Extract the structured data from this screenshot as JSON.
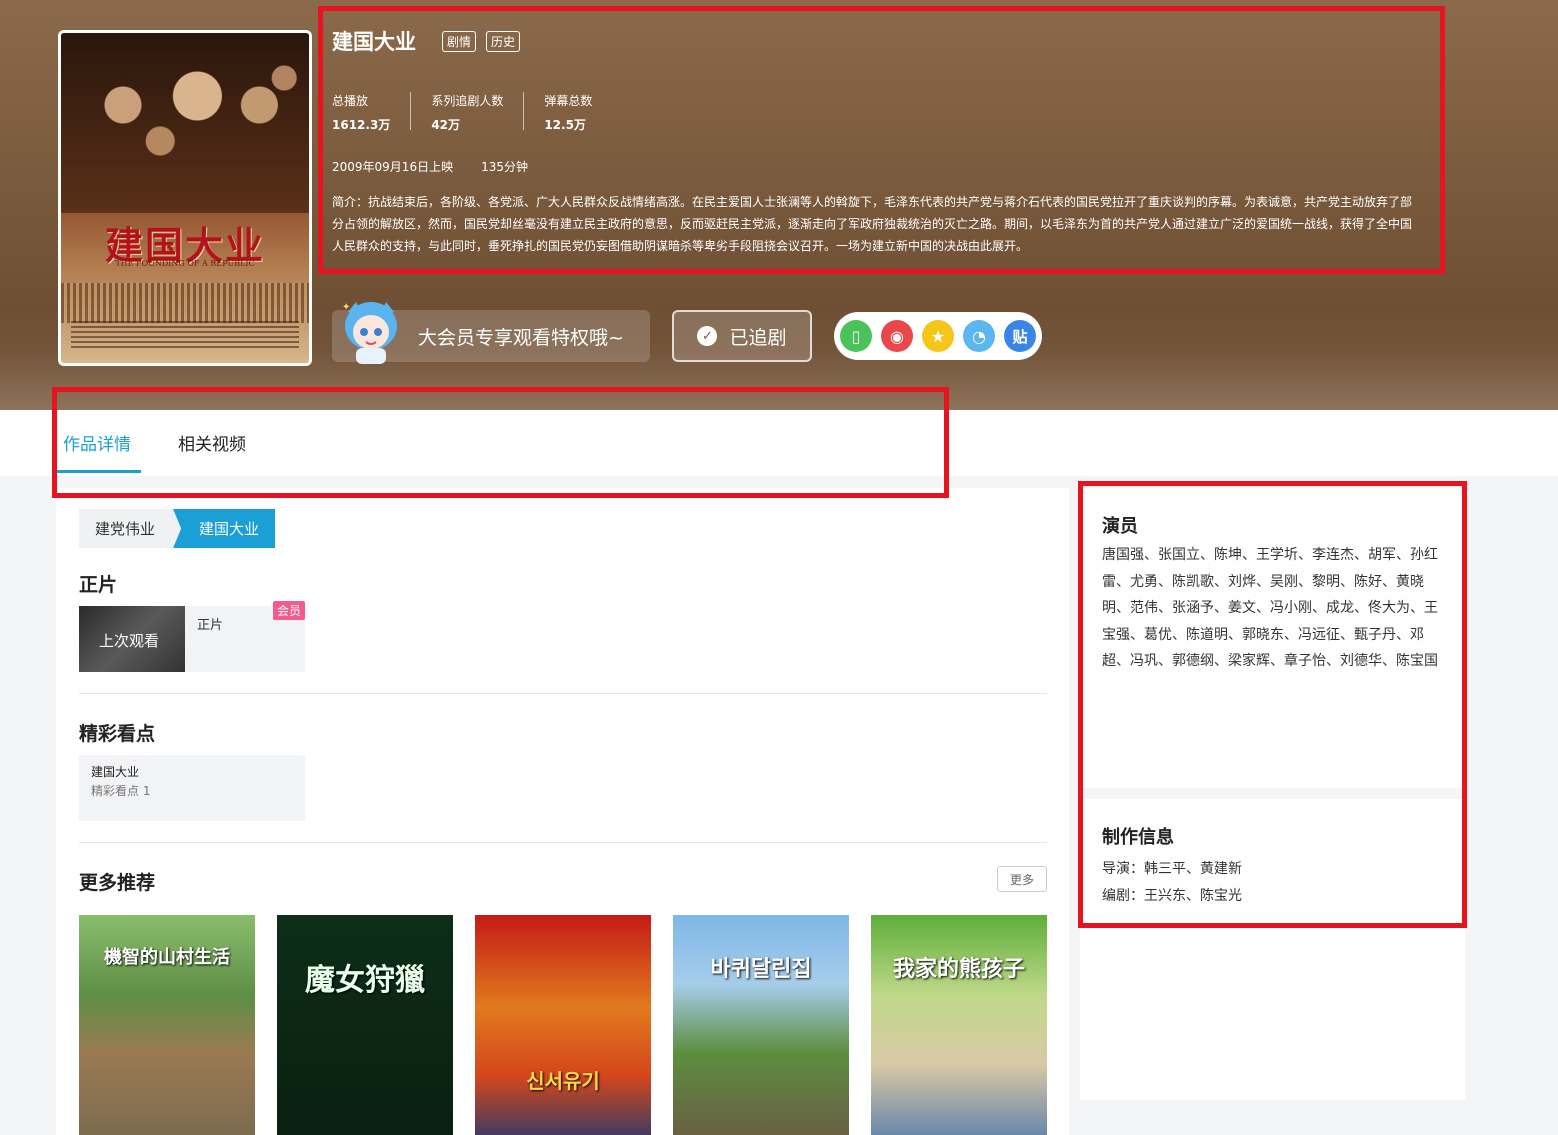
{
  "show": {
    "title": "建国大业",
    "tags": [
      "剧情",
      "历史"
    ],
    "poster": {
      "title": "建国大业",
      "subtitle": "THE FOUNDING OF A REPUBLIC"
    },
    "stats": [
      {
        "label": "总播放",
        "value": "1612.3万"
      },
      {
        "label": "系列追剧人数",
        "value": "42万"
      },
      {
        "label": "弹幕总数",
        "value": "12.5万"
      }
    ],
    "release": "2009年09月16日上映",
    "duration": "135分钟",
    "description": "简介：抗战结束后，各阶级、各党派、广大人民群众反战情绪高涨。在民主爱国人士张澜等人的斡旋下，毛泽东代表的共产党与蒋介石代表的国民党拉开了重庆谈判的序幕。为表诚意，共产党主动放弃了部分占领的解放区，然而，国民党却丝毫没有建立民主政府的意思，反而驱赶民主党派，逐渐走向了军政府独裁统治的灭亡之路。期间，以毛泽东为首的共产党人通过建立广泛的爱国统一战线，获得了全中国人民群众的支持，与此同时，垂死挣扎的国民党仍妄图借助阴谋暗杀等卑劣手段阻挠会议召开。一场为建立新中国的决战由此展开。"
  },
  "actions": {
    "vip_label": "大会员专享观看特权哦~",
    "follow_label": "已追剧",
    "share": [
      {
        "icon": "mobile-icon",
        "glyph": "▯",
        "color": "#4cc35a"
      },
      {
        "icon": "weibo-icon",
        "glyph": "◉",
        "color": "#e8474c"
      },
      {
        "icon": "qzone-icon",
        "glyph": "★",
        "color": "#f5c518"
      },
      {
        "icon": "qq-icon",
        "glyph": "◔",
        "color": "#5cb6f0"
      },
      {
        "icon": "tieba-icon",
        "glyph": "贴",
        "color": "#3a86e8"
      }
    ]
  },
  "tabs": [
    {
      "label": "作品详情",
      "active": true
    },
    {
      "label": "相关视频",
      "active": false
    }
  ],
  "series": [
    "建党伟业",
    "建国大业"
  ],
  "sections": {
    "main_feature": "正片",
    "highlights": "精彩看点",
    "more": "更多推荐",
    "more_button": "更多"
  },
  "episode": {
    "thumb_label": "上次观看",
    "label": "正片",
    "badge": "会员"
  },
  "highlight_card": {
    "title": "建国大业",
    "sub": "精彩看点 1"
  },
  "recommendations": [
    {
      "title": "機智的山村生活"
    },
    {
      "title": "魔女狩獵"
    },
    {
      "title": "신서유기"
    },
    {
      "title": "바퀴달린집"
    },
    {
      "title": "我家的熊孩子"
    }
  ],
  "side": {
    "cast_title": "演员",
    "cast": "唐国强、张国立、陈坤、王学圻、李连杰、胡军、孙红雷、尤勇、陈凯歌、刘烨、吴刚、黎明、陈好、黄晓明、范伟、张涵予、姜文、冯小刚、成龙、佟大为、王宝强、葛优、陈道明、郭晓东、冯远征、甄子丹、邓超、冯巩、郭德纲、梁家辉、章子怡、刘德华、陈宝国",
    "production_title": "制作信息",
    "director": "导演：韩三平、黄建新",
    "writer": "编剧：王兴东、陈宝光"
  }
}
